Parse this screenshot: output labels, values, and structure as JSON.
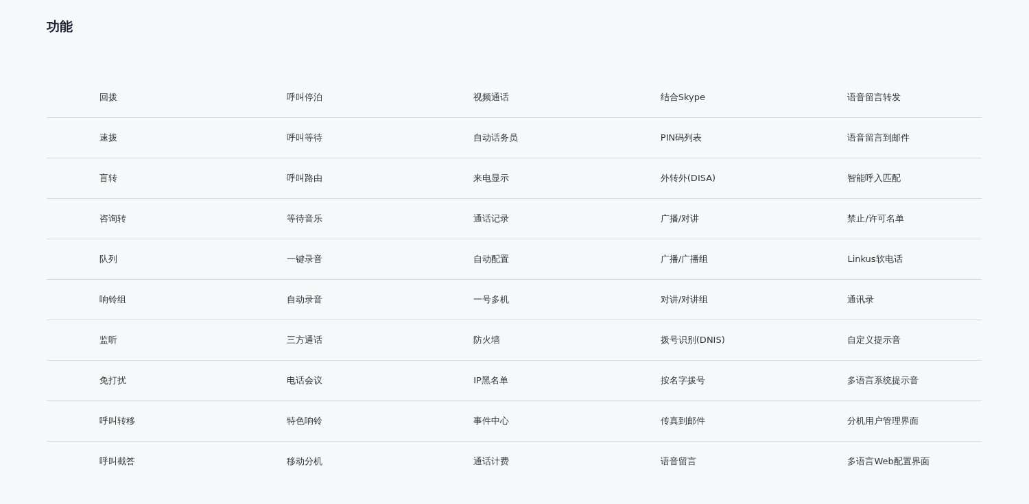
{
  "title": "功能",
  "table": {
    "rows": [
      [
        "回拨",
        "呼叫停泊",
        "视频通话",
        "结合Skype",
        "语音留言转发"
      ],
      [
        "速拨",
        "呼叫等待",
        "自动话务员",
        "PIN码列表",
        "语音留言到邮件"
      ],
      [
        "盲转",
        "呼叫路由",
        "来电显示",
        "外转外(DISA)",
        "智能呼入匹配"
      ],
      [
        "咨询转",
        "等待音乐",
        "通话记录",
        "广播/对讲",
        "禁止/许可名单"
      ],
      [
        "队列",
        "一键录音",
        "自动配置",
        "广播/广播组",
        "Linkus软电话"
      ],
      [
        "响铃组",
        "自动录音",
        "一号多机",
        "对讲/对讲组",
        "通讯录"
      ],
      [
        "监听",
        "三方通话",
        "防火墙",
        "拨号识别(DNIS)",
        "自定义提示音"
      ],
      [
        "免打扰",
        "电话会议",
        "IP黑名单",
        "按名字拨号",
        "多语言系统提示音"
      ],
      [
        "呼叫转移",
        "特色响铃",
        "事件中心",
        "传真到邮件",
        "分机用户管理界面"
      ],
      [
        "呼叫截答",
        "移动分机",
        "通话计费",
        "语音留言",
        "多语言Web配置界面"
      ]
    ]
  }
}
